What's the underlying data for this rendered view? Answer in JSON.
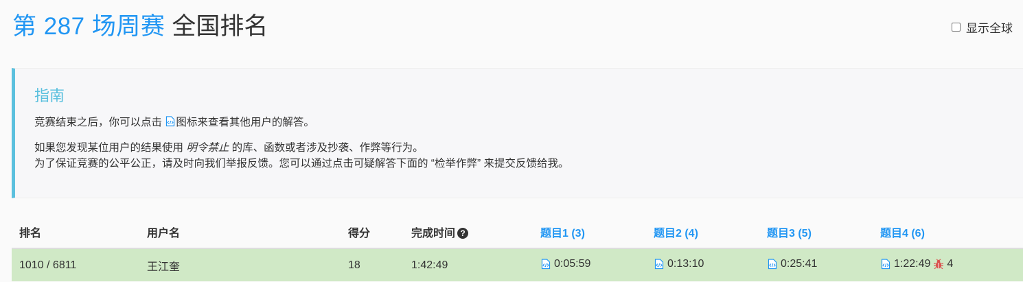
{
  "header": {
    "contest_title": "第 287 场周赛",
    "ranking_title": "全国排名",
    "global_toggle_label": "显示全球"
  },
  "guide": {
    "title": "指南",
    "line1_prefix": "竞赛结束之后，你可以点击",
    "line1_suffix": "图标来查看其他用户的解答。",
    "line2_prefix": "如果您发现某位用户的结果使用",
    "line2_em": "明令禁止",
    "line2_suffix": "的库、函数或者涉及抄袭、作弊等行为。",
    "line3": "为了保证竞赛的公平公正，请及时向我们举报反馈。您可以通过点击可疑解答下面的 “检举作弊” 来提交反馈给我。"
  },
  "table": {
    "columns": [
      "排名",
      "用户名",
      "得分",
      "完成时间",
      "题目1 (3)",
      "题目2 (4)",
      "题目3 (5)",
      "题目4 (6)"
    ],
    "rows": [
      {
        "rank": "1010 / 6811",
        "username": "王江奎",
        "score": "18",
        "finish_time": "1:42:49",
        "q1": "0:05:59",
        "q2": "0:13:10",
        "q3": "0:25:41",
        "q4": "1:22:49",
        "q4_penalty": "4"
      }
    ]
  },
  "colors": {
    "accent": "#2196f3",
    "guide_border": "#5bc0de",
    "row_highlight": "#d0e9c6",
    "bug": "#d9534f"
  },
  "icons": {
    "code": "file-code-icon",
    "help": "question-circle-icon",
    "bug": "bug-icon"
  }
}
